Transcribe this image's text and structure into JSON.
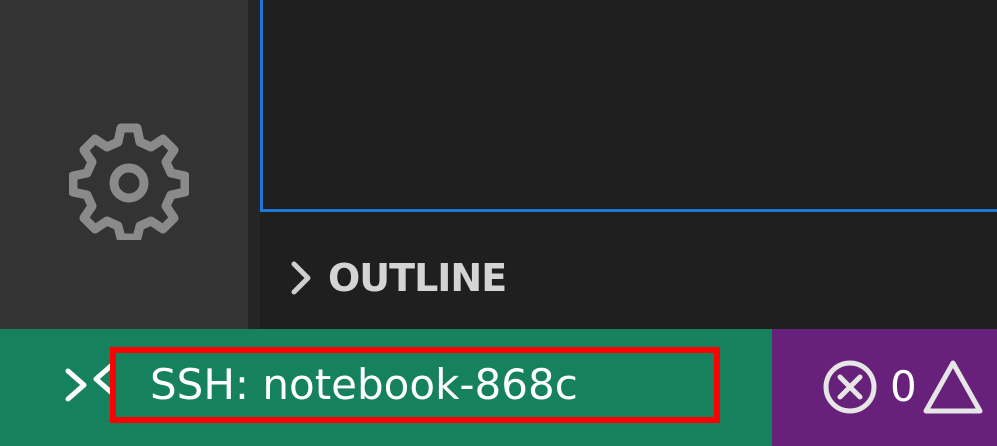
{
  "activity_bar": {
    "manage_icon": "gear-icon"
  },
  "side_bar": {
    "outline": {
      "title": "OUTLINE",
      "collapsed": true,
      "icon": "chevron-right-icon"
    }
  },
  "status_bar": {
    "remote": {
      "label": "SSH: notebook-868c",
      "icon": "remote-icon",
      "background": "#16825d",
      "highlight_border": "#ff0000"
    },
    "problems": {
      "errors": "0",
      "error_icon": "error-circle-icon",
      "warning_icon": "warning-icon",
      "background": "#68217a"
    }
  },
  "colors": {
    "focus_border": "#1c78d4",
    "activity_bar": "#333334",
    "editor": "#1e1e1e"
  }
}
